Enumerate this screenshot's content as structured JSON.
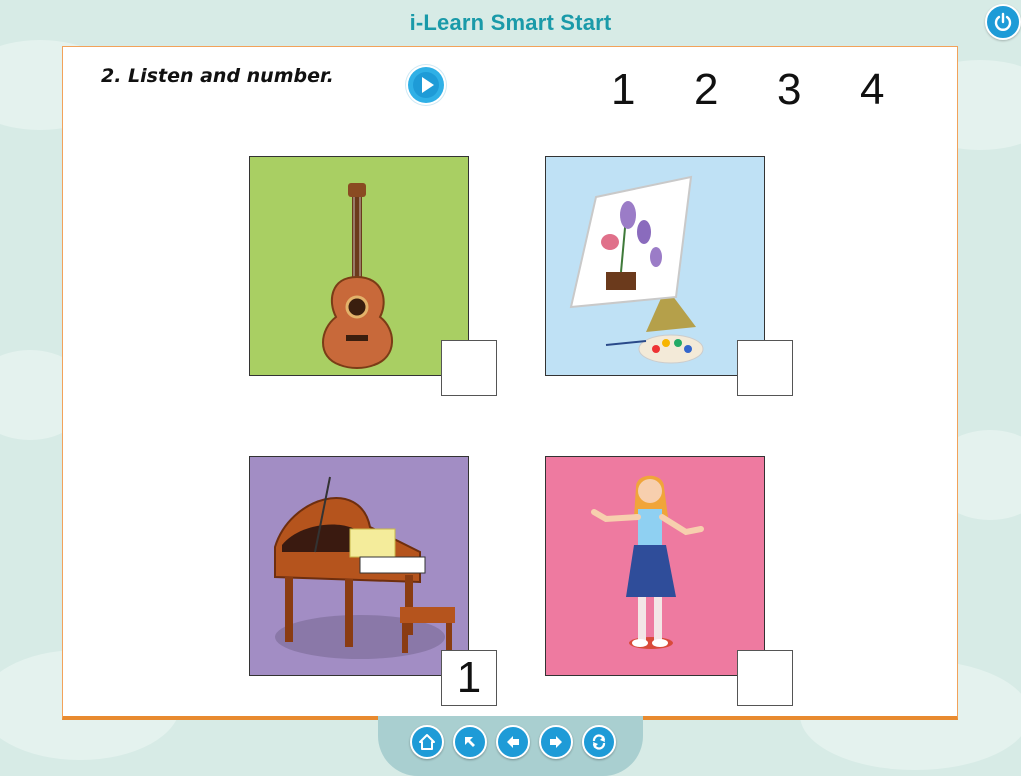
{
  "app": {
    "title": "i-Learn Smart Start"
  },
  "exercise": {
    "instruction": "2. Listen and number.",
    "number_options": [
      "1",
      "2",
      "3",
      "4"
    ]
  },
  "cards": [
    {
      "name": "guitar",
      "bg": "#a9cf63",
      "answer": ""
    },
    {
      "name": "painting",
      "bg": "#bfe1f5",
      "answer": ""
    },
    {
      "name": "piano",
      "bg": "#a28dc4",
      "answer": "1"
    },
    {
      "name": "dancer",
      "bg": "#ee7aa0",
      "answer": ""
    }
  ],
  "nav": {
    "buttons": [
      "home-icon",
      "back-to-start-icon",
      "previous-icon",
      "next-icon",
      "reload-icon"
    ]
  },
  "colors": {
    "accent": "#1e9bd7",
    "border": "#e88a2f",
    "title": "#1a9aa9"
  }
}
